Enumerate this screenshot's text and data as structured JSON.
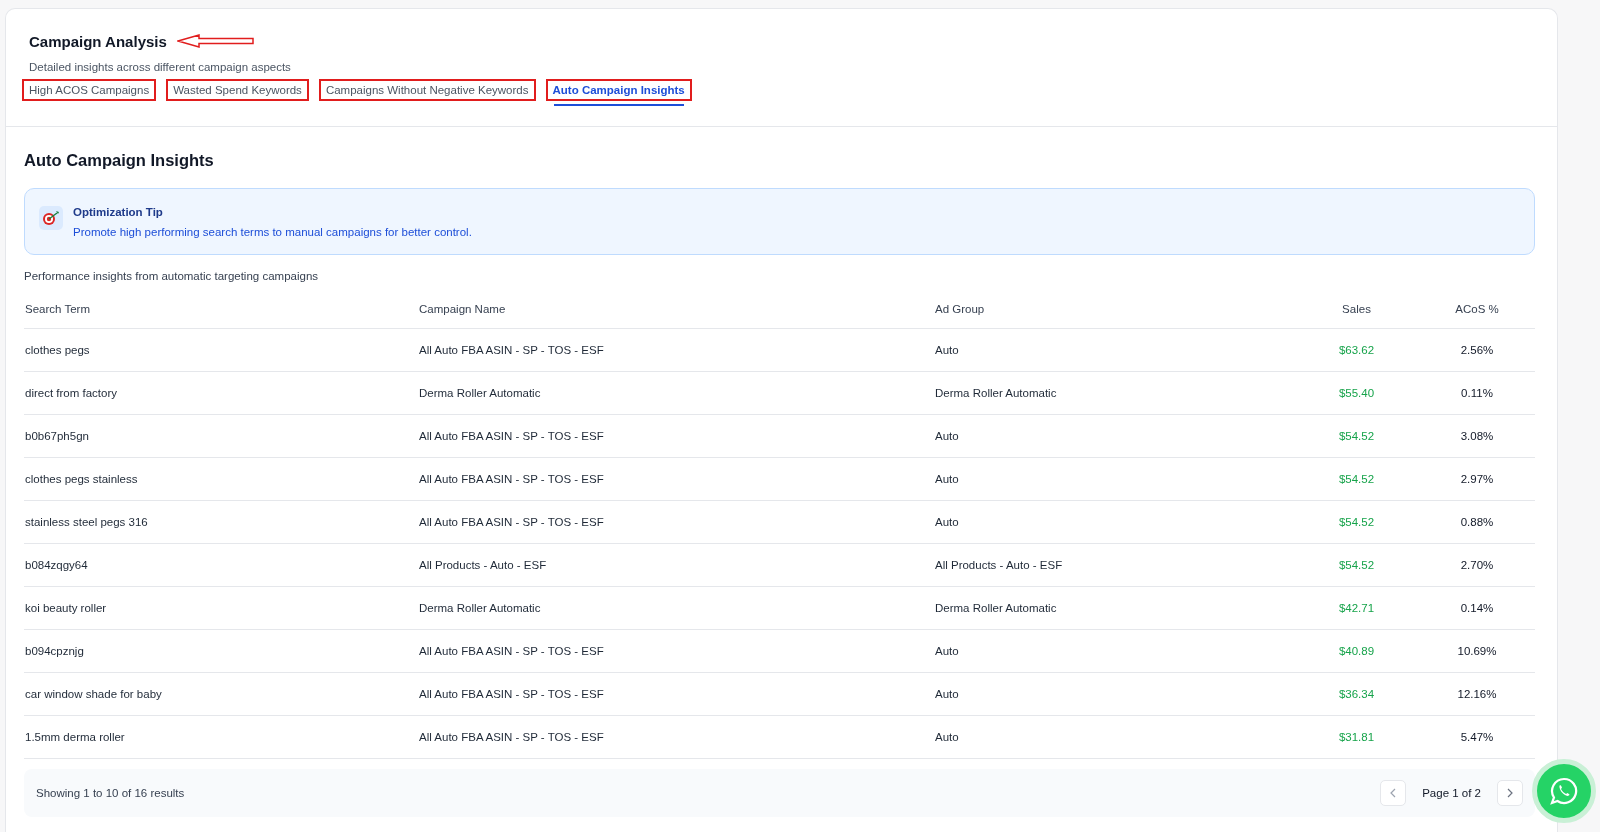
{
  "header": {
    "title": "Campaign Analysis",
    "title_arrow": true,
    "subtitle": "Detailed insights across different campaign aspects"
  },
  "tabs": [
    {
      "label": "High ACOS Campaigns",
      "selected": false,
      "boxed": true
    },
    {
      "label": "Wasted Spend Keywords",
      "selected": false,
      "boxed": true
    },
    {
      "label": "Campaigns Without Negative Keywords",
      "selected": false,
      "boxed": true
    },
    {
      "label": "Auto Campaign Insights",
      "selected": true,
      "boxed": true
    }
  ],
  "section": {
    "title": "Auto Campaign Insights",
    "tip": {
      "title": "Optimization Tip",
      "text": "Promote high performing search terms to manual campaigns for better control."
    },
    "description": "Performance insights from automatic targeting campaigns"
  },
  "table": {
    "columns": [
      {
        "label": "Search Term",
        "kind": "text"
      },
      {
        "label": "Campaign Name",
        "kind": "text"
      },
      {
        "label": "Ad Group",
        "kind": "text"
      },
      {
        "label": "Sales",
        "kind": "money"
      },
      {
        "label": "ACoS %",
        "kind": "percent"
      }
    ],
    "rows": [
      [
        "clothes pegs",
        "All Auto FBA ASIN - SP - TOS - ESF",
        "Auto",
        "$63.62",
        "2.56%"
      ],
      [
        "direct from factory",
        "Derma Roller Automatic",
        "Derma Roller Automatic",
        "$55.40",
        "0.11%"
      ],
      [
        "b0b67ph5gn",
        "All Auto FBA ASIN - SP - TOS - ESF",
        "Auto",
        "$54.52",
        "3.08%"
      ],
      [
        "clothes pegs stainless",
        "All Auto FBA ASIN - SP - TOS - ESF",
        "Auto",
        "$54.52",
        "2.97%"
      ],
      [
        "stainless steel pegs 316",
        "All Auto FBA ASIN - SP - TOS - ESF",
        "Auto",
        "$54.52",
        "0.88%"
      ],
      [
        "b084zqgy64",
        "All Products - Auto - ESF",
        "All Products - Auto - ESF",
        "$54.52",
        "2.70%"
      ],
      [
        "koi beauty roller",
        "Derma Roller Automatic",
        "Derma Roller Automatic",
        "$42.71",
        "0.14%"
      ],
      [
        "b094cpznjg",
        "All Auto FBA ASIN - SP - TOS - ESF",
        "Auto",
        "$40.89",
        "10.69%"
      ],
      [
        "car window shade for baby",
        "All Auto FBA ASIN - SP - TOS - ESF",
        "Auto",
        "$36.34",
        "12.16%"
      ],
      [
        "1.5mm derma roller",
        "All Auto FBA ASIN - SP - TOS - ESF",
        "Auto",
        "$31.81",
        "5.47%"
      ]
    ]
  },
  "footer": {
    "summary": "Showing 1 to 10 of 16 results",
    "page": "Page 1 of 2"
  }
}
